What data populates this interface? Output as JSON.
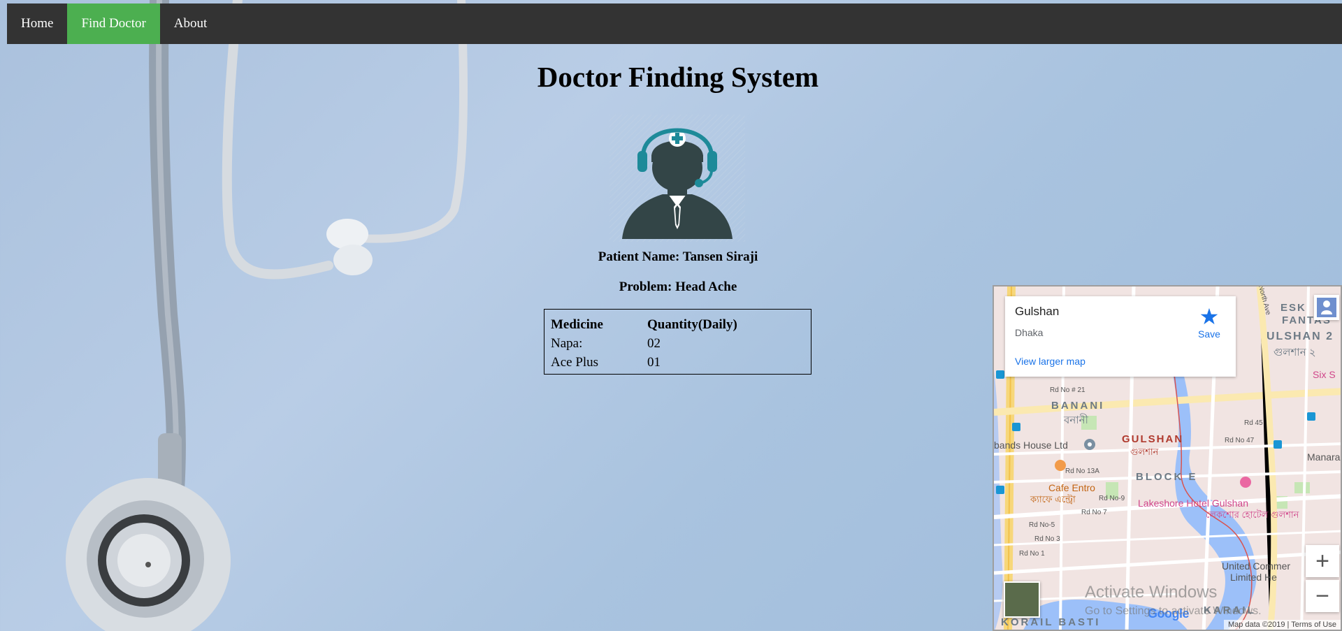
{
  "nav": {
    "items": [
      {
        "label": "Home",
        "active": false
      },
      {
        "label": "Find Doctor",
        "active": true
      },
      {
        "label": "About",
        "active": false
      }
    ],
    "active_color": "#4caf50",
    "bar_color": "#333333"
  },
  "page_title": "Doctor Finding System",
  "doctor_icon": "doctor-headset-icon",
  "patient": {
    "name_line": "Patient Name: Tansen Siraji",
    "problem_line": "Problem: Head Ache"
  },
  "prescription": {
    "headers": [
      "Medicine",
      "Quantity(Daily)"
    ],
    "rows": [
      [
        "Napa:",
        "02"
      ],
      [
        "Ace Plus",
        "01"
      ]
    ]
  },
  "map": {
    "place": "Gulshan",
    "city": "Dhaka",
    "save_label": "Save",
    "view_larger": "View larger map",
    "zoom_in": "+",
    "zoom_out": "−",
    "footer": "Map data ©2019 | Terms of Use",
    "google": "Google",
    "labels": {
      "banani": "BANANI",
      "banani_bn": "বনানী",
      "gulshan": "GULSHAN",
      "gulshan_bn": "গুলশান",
      "block_e": "BLOCK E",
      "gulshan2": "ULSHAN 2",
      "gulshan2_bn": "গুলশান ২",
      "esk": "ESK",
      "fanta": "FANTAS",
      "bands": "bands House Ltd",
      "cafe": "Cafe Entro",
      "cafe_bn": "ক্যাফে এন্ট্রো",
      "lakeshore": "Lakeshore Hotel Gulshan",
      "lakeshore_bn": "লেকশোর হোটেল গুলশান",
      "united": "United Commer",
      "limited": "Limited He",
      "six": "Six S",
      "manara": "Manara",
      "korail": "KARAIL",
      "korail_basti": "KORAIL BASTI",
      "rd21": "Rd No # 21",
      "rd13a": "Rd No 13A",
      "rd9": "Rd No-9",
      "rd7": "Rd No 7",
      "rd5": "Rd No-5",
      "rd3": "Rd No 3",
      "rd1": "Rd No 1",
      "rd47": "Rd No 47",
      "rd45": "Rd 45",
      "north_ave": "North Ave"
    }
  },
  "os_watermark": {
    "line1": "Activate Windows",
    "line2": "Go to Settings to activate Windows."
  }
}
